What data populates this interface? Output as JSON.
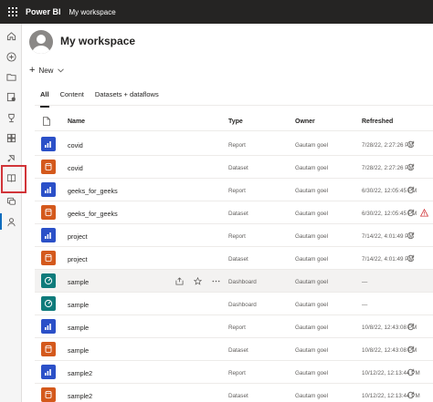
{
  "app": {
    "name": "Power BI",
    "breadcrumb": "My workspace"
  },
  "workspace": {
    "title": "My workspace"
  },
  "toolbar": {
    "new_label": "New"
  },
  "tabs": [
    {
      "label": "All",
      "active": true
    },
    {
      "label": "Content",
      "active": false
    },
    {
      "label": "Datasets + dataflows",
      "active": false
    }
  ],
  "columns": {
    "name": "Name",
    "type": "Type",
    "owner": "Owner",
    "refreshed": "Refreshed"
  },
  "rows": [
    {
      "name": "covid",
      "type": "Report",
      "owner": "Gautam goel",
      "refreshed": "7/28/22, 2:27:26 PM",
      "kind": "report",
      "refresh_icon": true,
      "warning": false
    },
    {
      "name": "covid",
      "type": "Dataset",
      "owner": "Gautam goel",
      "refreshed": "7/28/22, 2:27:26 PM",
      "kind": "dataset",
      "refresh_icon": true,
      "warning": false
    },
    {
      "name": "geeks_for_geeks",
      "type": "Report",
      "owner": "Gautam goel",
      "refreshed": "6/30/22, 12:05:45 PM",
      "kind": "report",
      "refresh_icon": true,
      "warning": false
    },
    {
      "name": "geeks_for_geeks",
      "type": "Dataset",
      "owner": "Gautam goel",
      "refreshed": "6/30/22, 12:05:45 PM",
      "kind": "dataset",
      "refresh_icon": true,
      "warning": true
    },
    {
      "name": "project",
      "type": "Report",
      "owner": "Gautam goel",
      "refreshed": "7/14/22, 4:01:49 PM",
      "kind": "report",
      "refresh_icon": true,
      "warning": false
    },
    {
      "name": "project",
      "type": "Dataset",
      "owner": "Gautam goel",
      "refreshed": "7/14/22, 4:01:49 PM",
      "kind": "dataset",
      "refresh_icon": true,
      "warning": false
    },
    {
      "name": "sample",
      "type": "Dashboard",
      "owner": "Gautam goel",
      "refreshed": "—",
      "kind": "dashboard",
      "refresh_icon": false,
      "warning": false,
      "hover": true
    },
    {
      "name": "sample",
      "type": "Dashboard",
      "owner": "Gautam goel",
      "refreshed": "—",
      "kind": "dashboard",
      "refresh_icon": false,
      "warning": false
    },
    {
      "name": "sample",
      "type": "Report",
      "owner": "Gautam goel",
      "refreshed": "10/8/22, 12:43:08 PM",
      "kind": "report",
      "refresh_icon": true,
      "warning": false
    },
    {
      "name": "sample",
      "type": "Dataset",
      "owner": "Gautam goel",
      "refreshed": "10/8/22, 12:43:08 PM",
      "kind": "dataset",
      "refresh_icon": true,
      "warning": false
    },
    {
      "name": "sample2",
      "type": "Report",
      "owner": "Gautam goel",
      "refreshed": "10/12/22, 12:13:44 PM",
      "kind": "report",
      "refresh_icon": true,
      "warning": false
    },
    {
      "name": "sample2",
      "type": "Dataset",
      "owner": "Gautam goel",
      "refreshed": "10/12/22, 12:13:44 PM",
      "kind": "dataset",
      "refresh_icon": true,
      "warning": false
    }
  ],
  "hover_actions": [
    "share-icon",
    "favorite-star-icon",
    "more-options-icon"
  ],
  "nav_icons": [
    "home-icon",
    "create-icon",
    "browse-icon",
    "data-hub-icon",
    "goals-icon",
    "apps-icon",
    "deployment-pipelines-icon",
    "learn-icon",
    "workspaces-icon",
    "my-workspace-icon"
  ],
  "colors": {
    "topbar": "#252423",
    "report": "#2b50c8",
    "dataset": "#d4591c",
    "dashboard": "#0f7b7b",
    "highlight": "#d13438",
    "warning": "#d13438"
  }
}
